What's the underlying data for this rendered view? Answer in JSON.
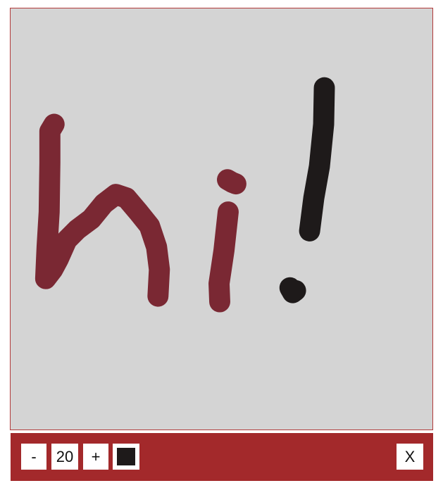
{
  "canvas": {
    "background_color": "#d4d4d4",
    "border_color": "#b23a3a",
    "strokes": [
      {
        "name": "h-stroke",
        "color": "#7a2833",
        "width": 30
      },
      {
        "name": "i-stem-stroke",
        "color": "#7a2833",
        "width": 30
      },
      {
        "name": "i-dot-stroke",
        "color": "#7a2833",
        "width": 30
      },
      {
        "name": "exclamation-bar-stroke",
        "color": "#1e1a1a",
        "width": 30
      },
      {
        "name": "exclamation-dot-stroke",
        "color": "#1e1a1a",
        "width": 30
      }
    ]
  },
  "toolbar": {
    "background_color": "#a3292b",
    "decrease_label": "-",
    "brush_size_value": "20",
    "increase_label": "+",
    "current_color": "#1e1a1a",
    "close_label": "X"
  }
}
